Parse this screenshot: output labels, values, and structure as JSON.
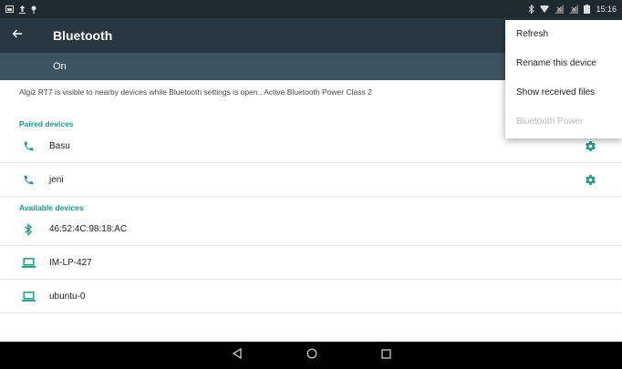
{
  "status_bar": {
    "time": "15:16"
  },
  "app_bar": {
    "title": "Bluetooth"
  },
  "switch": {
    "label": "On"
  },
  "visibility_text": "Algiz RT7 is visible to nearby devices while Bluetooth settings is open.. Active Bluetooth Power Class 2",
  "paired": {
    "header": "Paired devices",
    "items": [
      {
        "label": "Basu",
        "icon": "phone-icon"
      },
      {
        "label": "jeni",
        "icon": "phone-icon"
      }
    ]
  },
  "available": {
    "header": "Available devices",
    "items": [
      {
        "label": "46:52:4C:98:18:AC",
        "icon": "bluetooth-icon"
      },
      {
        "label": "IM-LP-427",
        "icon": "laptop-icon"
      },
      {
        "label": "ubuntu-0",
        "icon": "laptop-icon"
      }
    ]
  },
  "menu": {
    "items": [
      {
        "label": "Refresh",
        "enabled": true
      },
      {
        "label": "Rename this device",
        "enabled": true
      },
      {
        "label": "Show received files",
        "enabled": true
      },
      {
        "label": "Bluetooth Power",
        "enabled": false
      }
    ]
  },
  "colors": {
    "accent": "#1a9a8a",
    "app_bar": "#273840",
    "switch_bar": "#3c5461"
  }
}
